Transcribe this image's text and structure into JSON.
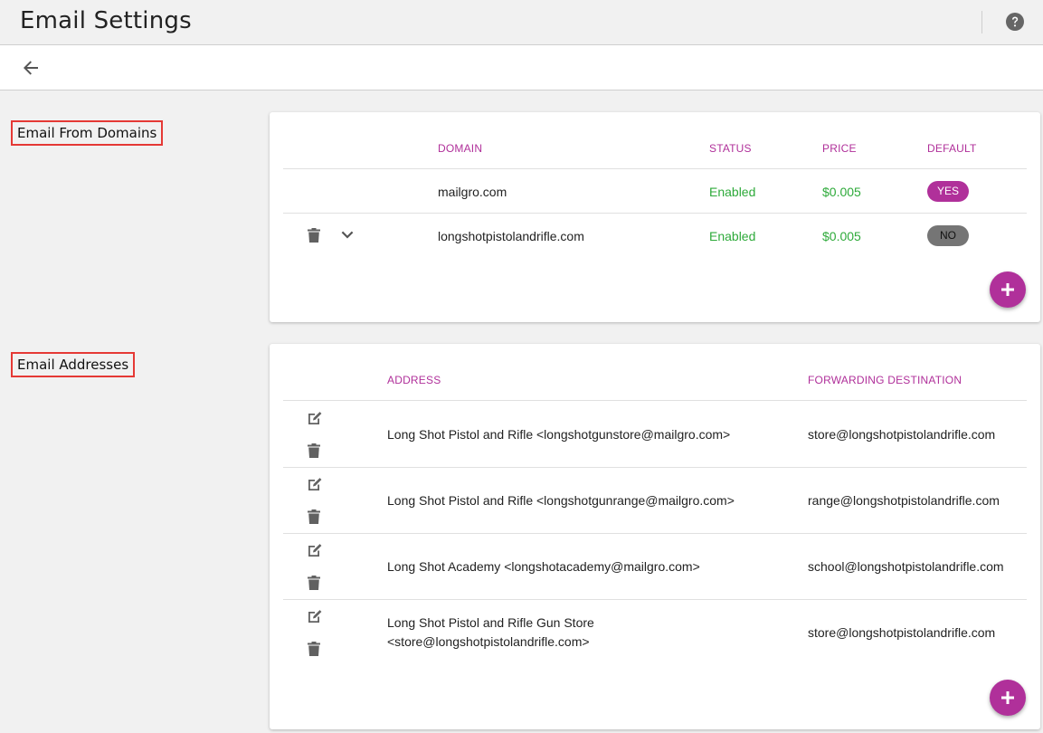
{
  "header": {
    "title": "Email Settings",
    "help_icon": "help-circle-icon",
    "back_icon": "arrow-left-icon"
  },
  "colors": {
    "accent": "#b0309a",
    "status_green": "#2eaa3a",
    "highlight_box": "#e53935"
  },
  "domains_section": {
    "label": "Email From Domains",
    "columns": [
      "DOMAIN",
      "STATUS",
      "PRICE",
      "DEFAULT"
    ],
    "rows": [
      {
        "domain": "mailgro.com",
        "status": "Enabled",
        "price": "$0.005",
        "default": "YES"
      },
      {
        "domain": "longshotpistolandrifle.com",
        "status": "Enabled",
        "price": "$0.005",
        "default": "NO"
      }
    ],
    "row_icons": [
      "trash-icon",
      "chevron-down-icon"
    ],
    "add_icon": "plus-icon"
  },
  "addresses_section": {
    "label": "Email Addresses",
    "columns": [
      "ADDRESS",
      "FORWARDING DESTINATION"
    ],
    "rows": [
      {
        "address": "Long Shot Pistol and Rifle <longshotgunstore@mailgro.com>",
        "forward": "store@longshotpistolandrifle.com"
      },
      {
        "address": "Long Shot Pistol and Rifle <longshotgunrange@mailgro.com>",
        "forward": "range@longshotpistolandrifle.com"
      },
      {
        "address": "Long Shot Academy <longshotacademy@mailgro.com>",
        "forward": "school@longshotpistolandrifle.com"
      },
      {
        "address": "Long Shot Pistol and Rifle Gun Store <store@longshotpistolandrifle.com>",
        "forward": "store@longshotpistolandrifle.com"
      }
    ],
    "row_icons": [
      "edit-icon",
      "trash-icon"
    ],
    "add_icon": "plus-icon"
  }
}
